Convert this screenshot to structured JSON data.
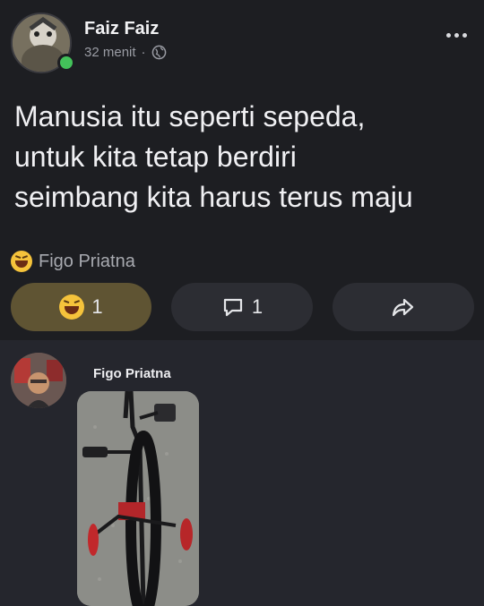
{
  "post": {
    "author": "Faiz Faiz",
    "time": "32 menit",
    "separator": "·",
    "text_lines": [
      "Manusia itu seperti sepeda,",
      "untuk kita tetap berdiri",
      "seimbang kita harus terus maju"
    ],
    "reacted_by": "Figo Priatna",
    "reaction_icon": "laughing-emoji-icon",
    "privacy_icon": "globe-icon",
    "online": true
  },
  "actions": {
    "reaction_count": "1",
    "comment_count": "1",
    "reaction_active_color": "#5f5433",
    "comment_icon": "speech-bubble-icon",
    "share_icon": "share-arrow-icon"
  },
  "comment": {
    "author": "Figo Priatna",
    "attachment": "photo of a bicycle with training wheels"
  },
  "colors": {
    "post_bg": "#1d1e22",
    "page_bg": "#25262d",
    "online_dot": "#43c25a"
  }
}
